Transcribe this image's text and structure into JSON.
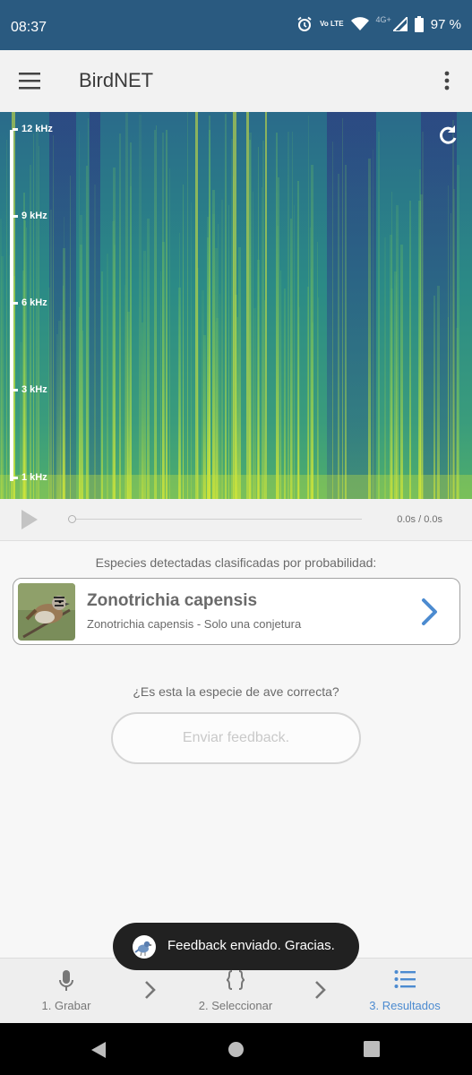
{
  "status_bar": {
    "time": "08:37",
    "network": "4G+",
    "volte": "Vo LTE",
    "battery": "97 %"
  },
  "app_bar": {
    "title": "BirdNET"
  },
  "spectrogram": {
    "freq_labels": [
      "12 kHz",
      "9 kHz",
      "6 kHz",
      "3 kHz",
      "1 kHz"
    ]
  },
  "player": {
    "time": "0.0s / 0.0s",
    "progress": 0
  },
  "results": {
    "caption": "Especies detectadas clasificadas por probabilidad:",
    "species": [
      {
        "name": "Zonotrichia capensis",
        "subtitle": "Zonotrichia capensis - Solo una conjetura"
      }
    ],
    "question": "¿Es esta la especie de ave correcta?",
    "feedback_button": "Enviar feedback."
  },
  "bottom_nav": {
    "items": [
      {
        "label": "1. Grabar",
        "icon": "microphone-icon"
      },
      {
        "label": "2. Seleccionar",
        "icon": "braces-icon"
      },
      {
        "label": "3. Resultados",
        "icon": "list-icon"
      }
    ],
    "active_index": 2
  },
  "toast": {
    "text": "Feedback enviado. Gracias."
  },
  "colors": {
    "status_bar": "#2a5a80",
    "accent": "#4c8bd0",
    "spectrogram_base": "#2c7a8c",
    "spectrogram_high": "#c8e23a"
  }
}
